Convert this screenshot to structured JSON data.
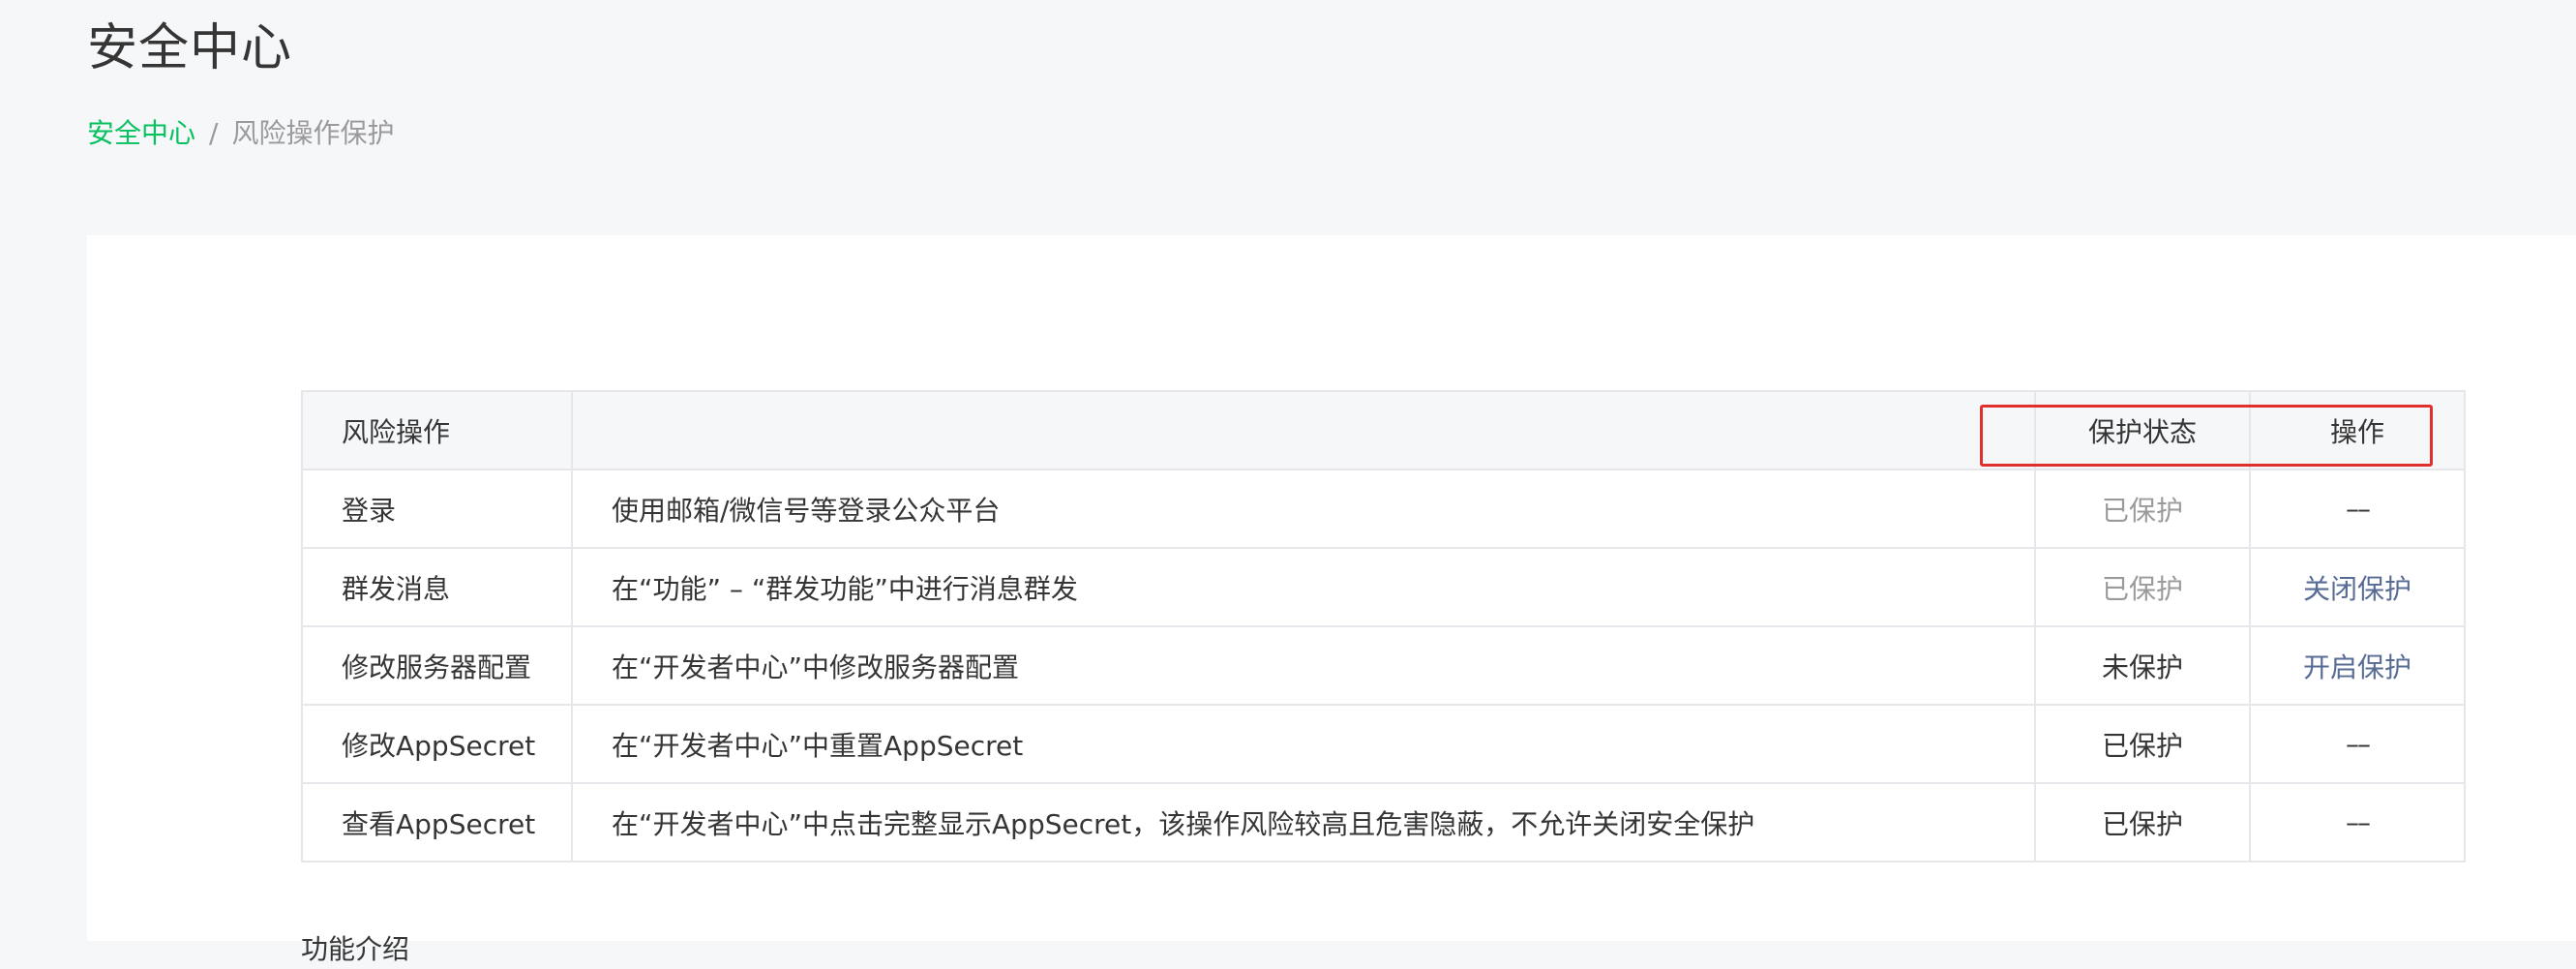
{
  "page": {
    "title": "安全中心"
  },
  "breadcrumb": {
    "home": "安全中心",
    "separator": "/",
    "current": "风险操作保护"
  },
  "table": {
    "headers": {
      "operation": "风险操作",
      "description": "",
      "status": "保护状态",
      "action": "操作"
    },
    "rows": [
      {
        "operation": "登录",
        "description": "使用邮箱/微信号等登录公众平台",
        "status": "已保护",
        "status_style": "muted",
        "action": "––",
        "action_type": "none"
      },
      {
        "operation": "群发消息",
        "description": "在“功能” – “群发功能”中进行消息群发",
        "status": "已保护",
        "status_style": "muted",
        "action": "关闭保护",
        "action_type": "link"
      },
      {
        "operation": "修改服务器配置",
        "description": "在“开发者中心”中修改服务器配置",
        "status": "未保护",
        "status_style": "normal",
        "action": "开启保护",
        "action_type": "link",
        "highlighted": true
      },
      {
        "operation": "修改AppSecret",
        "description": "在“开发者中心”中重置AppSecret",
        "status": "已保护",
        "status_style": "normal",
        "action": "––",
        "action_type": "none"
      },
      {
        "operation": "查看AppSecret",
        "description": "在“开发者中心”中点击完整显示AppSecret，该操作风险较高且危害隐蔽，不允许关闭安全保护",
        "status": "已保护",
        "status_style": "normal",
        "action": "––",
        "action_type": "none"
      }
    ]
  },
  "footer": {
    "section_label": "功能介绍"
  },
  "colors": {
    "accent_green": "#07c160",
    "link_blue": "#576b95",
    "highlight_red": "#e0302d",
    "muted_gray": "#9a9a9a",
    "page_background": "#f6f7f9"
  }
}
